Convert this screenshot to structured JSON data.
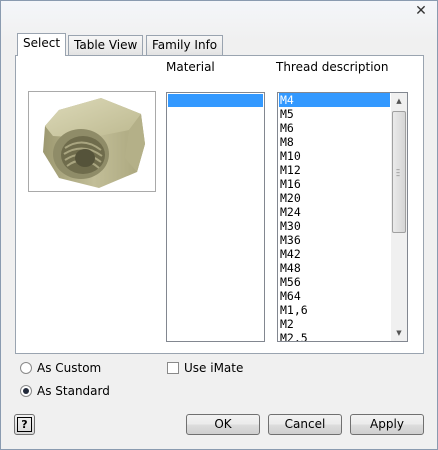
{
  "window": {
    "close_glyph": "✕"
  },
  "tabs": [
    {
      "label": "Select",
      "active": true
    },
    {
      "label": "Table View",
      "active": false
    },
    {
      "label": "Family Info",
      "active": false
    }
  ],
  "columns": {
    "material": "Material",
    "thread": "Thread description"
  },
  "preview": {
    "icon": "hex-nut-icon"
  },
  "material_list": {
    "items": [
      ""
    ],
    "selected_index": 0
  },
  "thread_list": {
    "items": [
      "M4",
      "M5",
      "M6",
      "M8",
      "M10",
      "M12",
      "M16",
      "M20",
      "M24",
      "M30",
      "M36",
      "M42",
      "M48",
      "M56",
      "M64",
      "M1,6",
      "M2",
      "M2,5"
    ],
    "selected_index": 0
  },
  "options": {
    "as_custom": {
      "label": "As Custom",
      "checked": false
    },
    "as_standard": {
      "label": "As Standard",
      "checked": true
    },
    "use_imate": {
      "label": "Use iMate",
      "checked": false
    }
  },
  "buttons": {
    "help": "?",
    "ok": "OK",
    "cancel": "Cancel",
    "apply": "Apply"
  },
  "colors": {
    "selection": "#3399ff",
    "nut": "#c8c4a0"
  }
}
